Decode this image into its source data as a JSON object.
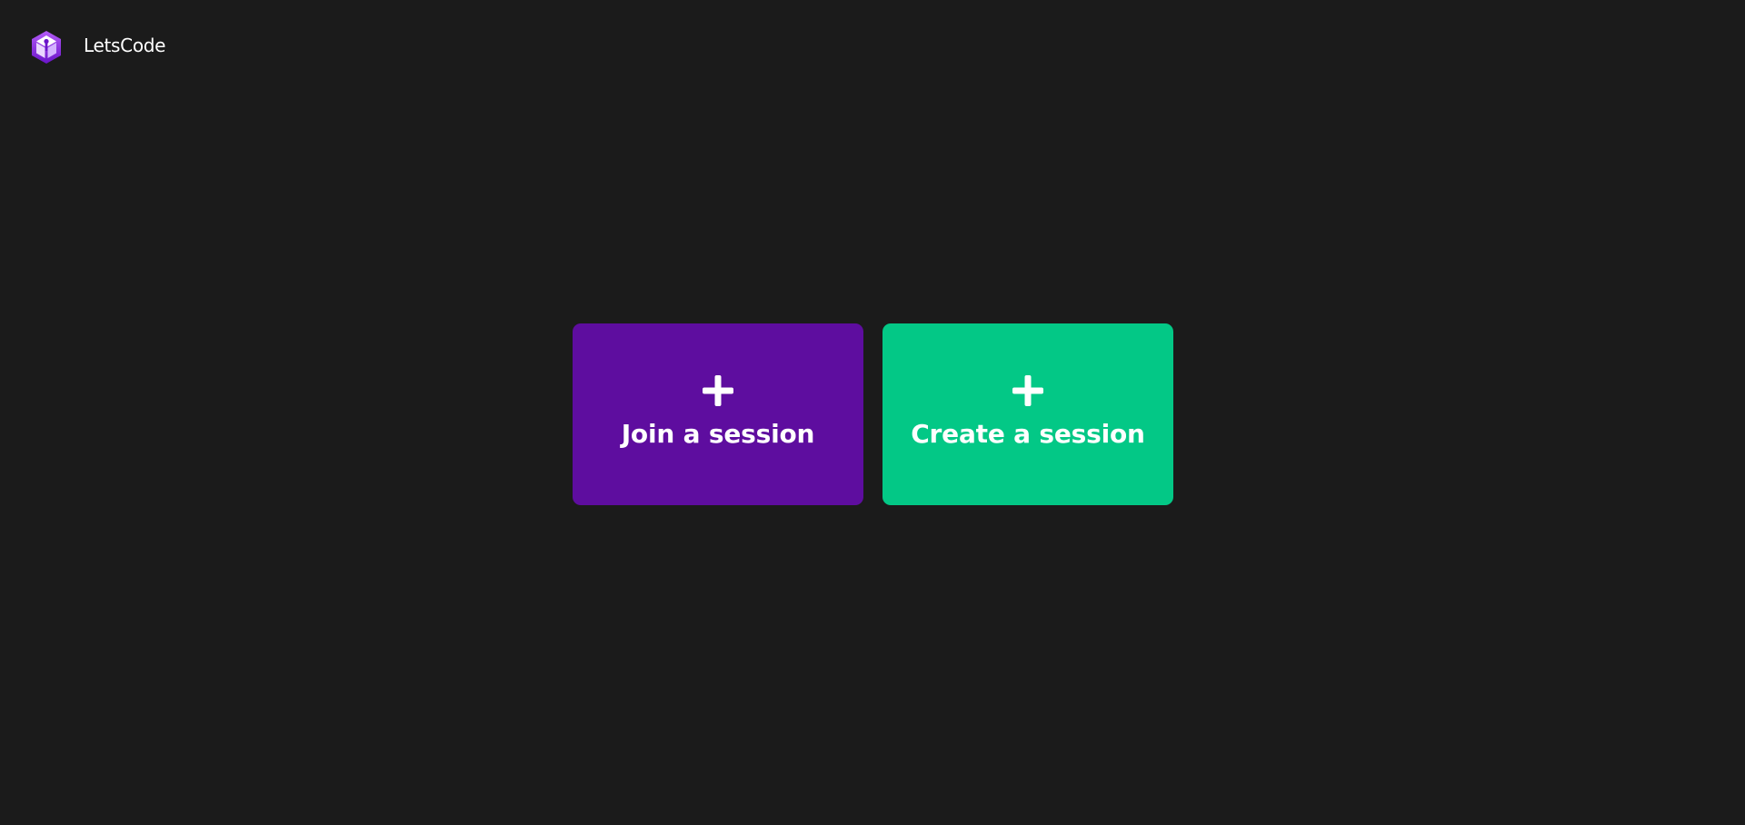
{
  "header": {
    "brand": "LetsCode",
    "logo_icon": "cube-logo-icon"
  },
  "actions": {
    "join": {
      "label": "Join a session",
      "icon": "plus-icon",
      "color": "#5e0d9f"
    },
    "create": {
      "label": "Create a session",
      "icon": "plus-icon",
      "color": "#03c886"
    }
  },
  "colors": {
    "background": "#1b1b1b",
    "logo_purple": "#a64bf4"
  }
}
